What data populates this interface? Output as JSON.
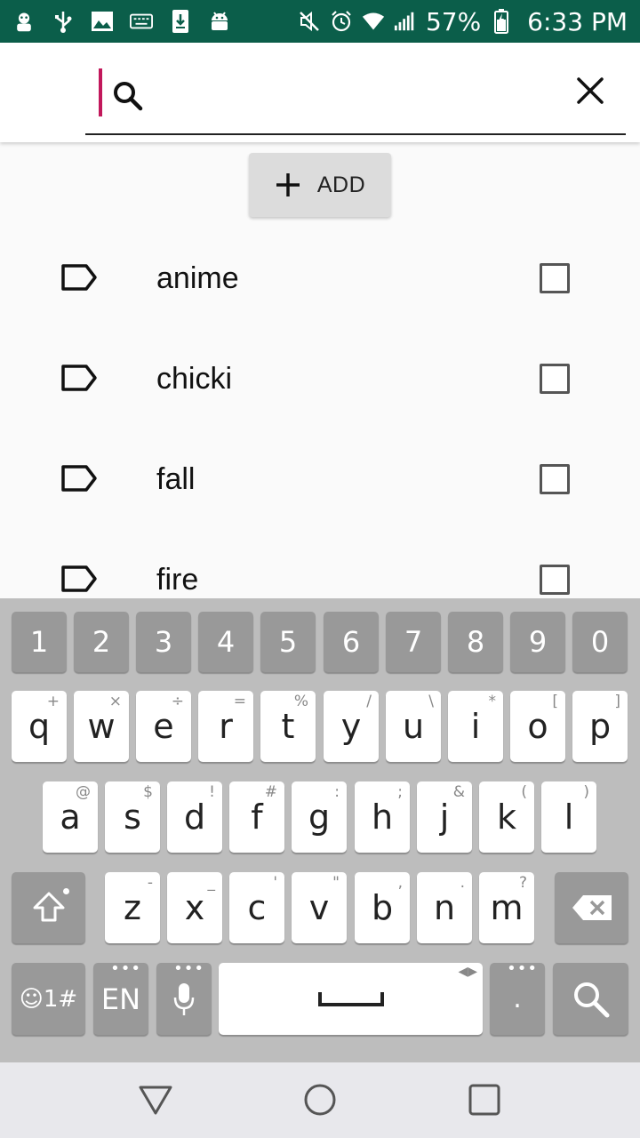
{
  "status_bar": {
    "battery": "57%",
    "time": "6:33 PM",
    "icons": [
      "app-avatar-icon",
      "usb-icon",
      "image-icon",
      "keyboard-icon",
      "download-icon",
      "android-icon",
      "mute-icon",
      "alarm-icon",
      "wifi-icon",
      "signal-icon",
      "battery-icon"
    ]
  },
  "search": {
    "value": "",
    "placeholder": ""
  },
  "add_button": {
    "label": "ADD"
  },
  "tags": [
    {
      "label": "anime",
      "checked": false
    },
    {
      "label": "chicki",
      "checked": false
    },
    {
      "label": "fall",
      "checked": false
    },
    {
      "label": "fire",
      "checked": false
    }
  ],
  "keyboard": {
    "numbers": [
      "1",
      "2",
      "3",
      "4",
      "5",
      "6",
      "7",
      "8",
      "9",
      "0"
    ],
    "row1": [
      {
        "key": "q",
        "hint": "+"
      },
      {
        "key": "w",
        "hint": "×"
      },
      {
        "key": "e",
        "hint": "÷"
      },
      {
        "key": "r",
        "hint": "="
      },
      {
        "key": "t",
        "hint": "%"
      },
      {
        "key": "y",
        "hint": "/"
      },
      {
        "key": "u",
        "hint": "\\"
      },
      {
        "key": "i",
        "hint": "*"
      },
      {
        "key": "o",
        "hint": "["
      },
      {
        "key": "p",
        "hint": "]"
      }
    ],
    "row2": [
      {
        "key": "a",
        "hint": "@"
      },
      {
        "key": "s",
        "hint": "$"
      },
      {
        "key": "d",
        "hint": "!"
      },
      {
        "key": "f",
        "hint": "#"
      },
      {
        "key": "g",
        "hint": ":"
      },
      {
        "key": "h",
        "hint": ";"
      },
      {
        "key": "j",
        "hint": "&"
      },
      {
        "key": "k",
        "hint": "("
      },
      {
        "key": "l",
        "hint": ")"
      }
    ],
    "row3": [
      {
        "key": "z",
        "hint": "-"
      },
      {
        "key": "x",
        "hint": "_"
      },
      {
        "key": "c",
        "hint": "'"
      },
      {
        "key": "v",
        "hint": "\""
      },
      {
        "key": "b",
        "hint": ","
      },
      {
        "key": "n",
        "hint": "."
      },
      {
        "key": "m",
        "hint": "?"
      }
    ],
    "symbols_label": "☺1#",
    "language_label": "EN",
    "period_label": "."
  },
  "colors": {
    "status_bar": "#0b5e4a",
    "cursor": "#c2185b"
  }
}
